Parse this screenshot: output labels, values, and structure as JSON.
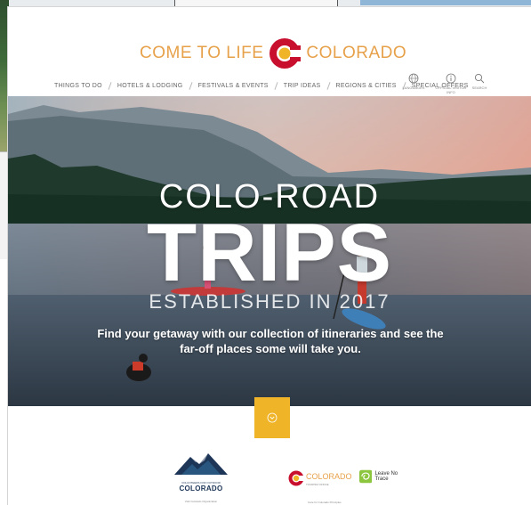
{
  "header": {
    "logo_left": "COME TO LIFE",
    "logo_right": "COLORADO"
  },
  "nav": {
    "items": [
      {
        "label": "Things to Do"
      },
      {
        "label": "Hotels & Lodging"
      },
      {
        "label": "Festivals & Events"
      },
      {
        "label": "Trip Ideas"
      },
      {
        "label": "Regions & Cities"
      },
      {
        "label": "Special Offers"
      }
    ],
    "utility": [
      {
        "label": "Languages",
        "icon": "globe-icon"
      },
      {
        "label": "Official Visitor Info",
        "icon": "info-icon"
      },
      {
        "label": "Search",
        "icon": "search-icon"
      }
    ]
  },
  "hero": {
    "kicker": "COLO-ROAD",
    "title": "TRIPS",
    "established": "ESTABLISHED IN 2017",
    "description": "Find your getaway with our collection of itineraries and see the far-off places some will take you."
  },
  "partners": {
    "p1_name": "COLORADO",
    "p1_sub": "VOLUNTEERS FOR OUTDOOR",
    "p1_tag": "Visit Colorado Organization",
    "p2_name": "COLORADO",
    "p2_sub": "TOURISM OFFICE",
    "p2_tag": "Care for Colorado Principles",
    "lnt_label": "Leave No Trace"
  },
  "colors": {
    "brand_gold": "#f0b429",
    "brand_red": "#c8102e",
    "logo_orange": "#e7a14a"
  }
}
